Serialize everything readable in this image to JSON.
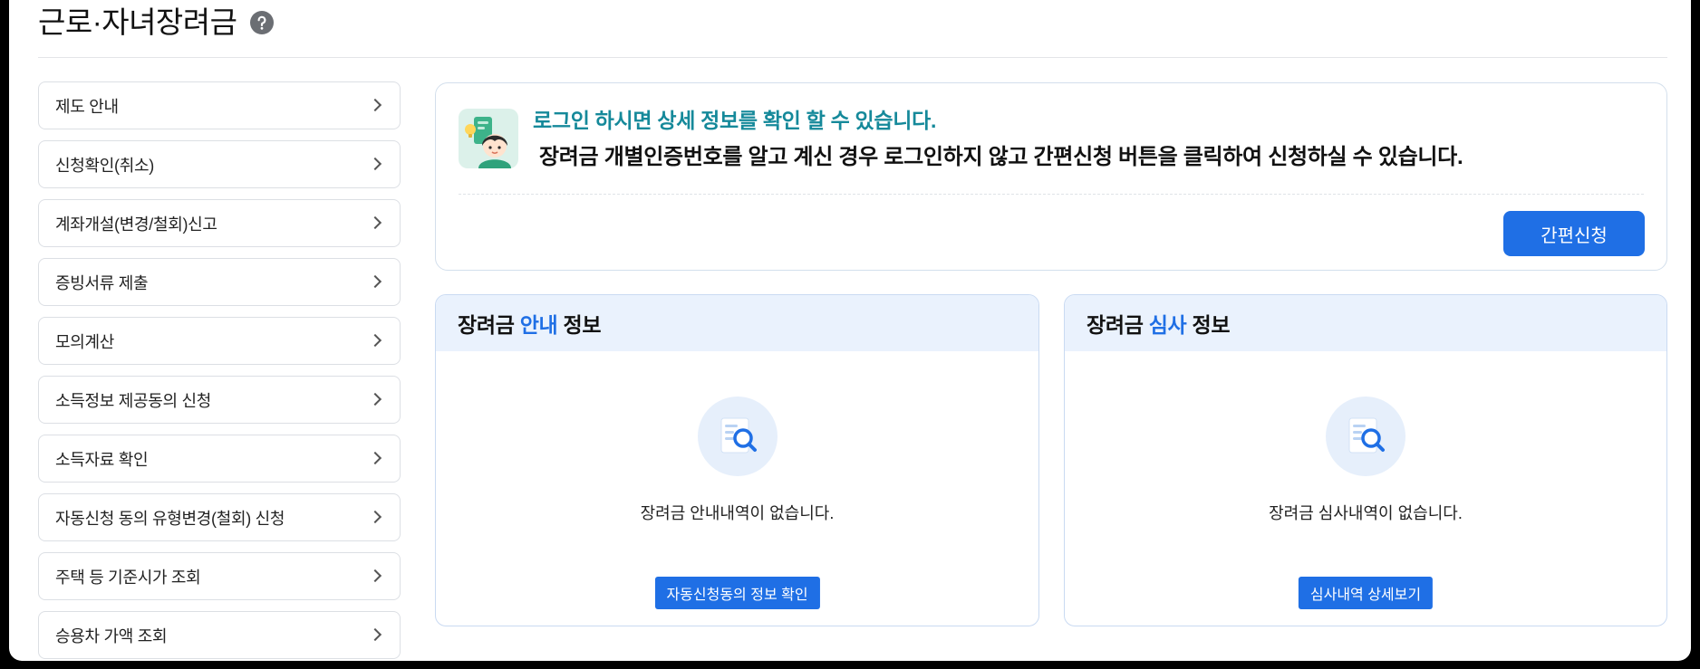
{
  "page": {
    "title": "근로·자녀장려금",
    "help_icon": "question-circle-icon"
  },
  "sidebar": {
    "chevron_icon": "chevron-right-icon",
    "items": [
      {
        "label": "제도 안내"
      },
      {
        "label": "신청확인(취소)"
      },
      {
        "label": "계좌개설(변경/철회)신고"
      },
      {
        "label": "증빙서류 제출"
      },
      {
        "label": "모의계산"
      },
      {
        "label": "소득정보 제공동의 신청"
      },
      {
        "label": "소득자료 확인"
      },
      {
        "label": "자동신청 동의 유형변경(철회) 신청"
      },
      {
        "label": "주택 등 기준시가 조회"
      },
      {
        "label": "승용차 가액 조회"
      }
    ]
  },
  "login_notice": {
    "icon": "login-character-icon",
    "headline": "로그인 하시면 상세 정보를 확인 할 수 있습니다.",
    "description": "장려금 개별인증번호를 알고 계신 경우 로그인하지 않고 간편신청 버튼을 클릭하여 신청하실 수 있습니다.",
    "button_label": "간편신청"
  },
  "guide_panel": {
    "title_prefix": "장려금",
    "title_highlight": "안내",
    "title_suffix": "정보",
    "icon": "document-search-icon",
    "empty_text": "장려금 안내내역이 없습니다.",
    "button_label": "자동신청동의 정보 확인"
  },
  "review_panel": {
    "title_prefix": "장려금",
    "title_highlight": "심사",
    "title_suffix": "정보",
    "icon": "document-search-icon",
    "empty_text": "장려금 심사내역이 없습니다.",
    "button_label": "심사내역 상세보기"
  },
  "colors": {
    "accent": "#1f6fe5",
    "notice": "#15899a",
    "panel-head": "#eaf2fd",
    "panel-border": "#c9daf2",
    "box-border": "#d3dfec",
    "item-border": "#dcdfe4"
  }
}
